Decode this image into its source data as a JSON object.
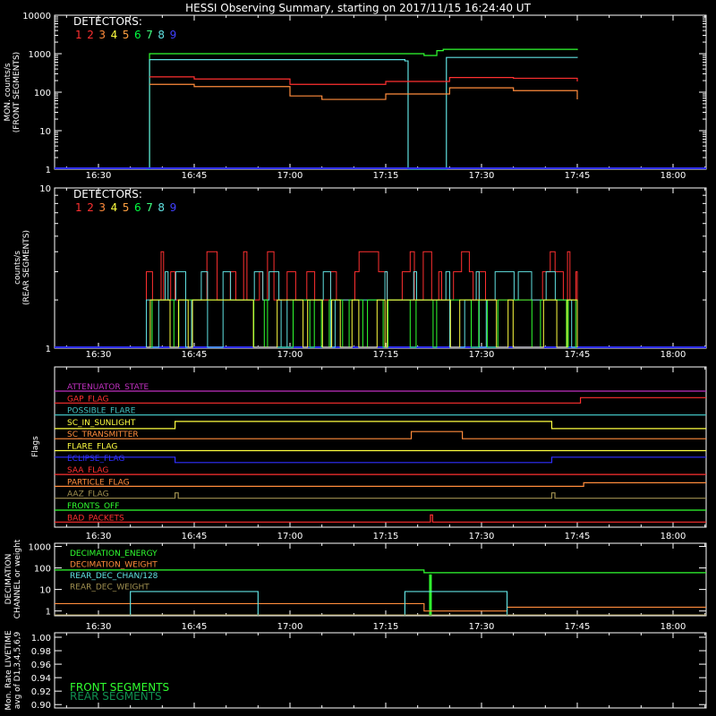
{
  "title": "HESSI Observing Summary, starting on 2017/11/15 16:24:40 UT",
  "x_tick_labels": [
    "16:30",
    "16:45",
    "17:00",
    "17:15",
    "17:30",
    "17:45",
    "18:00"
  ],
  "colors": {
    "axes": "#ffffff",
    "det": [
      "#ff3030",
      "#ff3030",
      "#ff8c3c",
      "#ffff40",
      "#ffa040",
      "#00ff40",
      "#40ff80",
      "#60e0e0",
      "#4040ff"
    ],
    "front_green": "#30ff30",
    "front_red": "#ff3030",
    "front_orange": "#ff8c3c",
    "front_cyan": "#60e0e0",
    "blue": "#3030ff"
  },
  "detectors": {
    "label": "DETECTORS:",
    "numbers": [
      "1",
      "2",
      "3",
      "4",
      "5",
      "6",
      "7",
      "8",
      "9"
    ]
  },
  "panels": {
    "front": {
      "ylabel_1": "MON. counts/s",
      "ylabel_2": "(FRONT SEGMENTS)",
      "yticks": [
        "10000",
        "1000",
        "100",
        "10",
        "1"
      ]
    },
    "rear": {
      "ylabel_1": "counts/s",
      "ylabel_2": "(REAR SEGMENTS)",
      "yticks": [
        "10",
        "1"
      ]
    },
    "flags": {
      "ylabel": "Flags",
      "items": [
        {
          "label": "ATTENUATOR_STATE",
          "color": "#c030c0"
        },
        {
          "label": "GAP_FLAG",
          "color": "#ff3030"
        },
        {
          "label": "POSSIBLE_FLARE",
          "color": "#40c0c0"
        },
        {
          "label": "SC_IN_SUNLIGHT",
          "color": "#ffff40"
        },
        {
          "label": "SC_TRANSMITTER",
          "color": "#ff8c3c"
        },
        {
          "label": "FLARE_FLAG",
          "color": "#ffff40"
        },
        {
          "label": "ECLIPSE_FLAG",
          "color": "#3030ff"
        },
        {
          "label": "SAA_FLAG",
          "color": "#ff3030"
        },
        {
          "label": "PARTICLE_FLAG",
          "color": "#ff8c3c"
        },
        {
          "label": "AAZ_FLAG",
          "color": "#a09050"
        },
        {
          "label": "FRONTS_OFF",
          "color": "#30ff30"
        },
        {
          "label": "BAD_PACKETS",
          "color": "#ff3030"
        }
      ]
    },
    "decimation": {
      "ylabel_1": "DECIMATION",
      "ylabel_2": "CHANNEL or weight",
      "yticks": [
        "1000",
        "100",
        "10",
        "1"
      ],
      "legend": [
        {
          "label": "DECIMATION_ENERGY",
          "color": "#30ff30"
        },
        {
          "label": "DECIMATION_WEIGHT",
          "color": "#ff8c3c"
        },
        {
          "label": "REAR_DEC_CHAN/128",
          "color": "#60e0e0"
        },
        {
          "label": "REAR_DEC_WEIGHT",
          "color": "#a09050"
        }
      ]
    },
    "livetime": {
      "ylabel_1": "Mon. Rate LIVETIME",
      "ylabel_2": "avg of D1,3,4,5,6,9",
      "yticks": [
        "1.00",
        "0.98",
        "0.96",
        "0.94",
        "0.92",
        "0.90"
      ],
      "legend": [
        {
          "label": "FRONT SEGMENTS",
          "color": "#30ff30"
        },
        {
          "label": "REAR SEGMENTS",
          "color": "#109050"
        }
      ]
    }
  },
  "chart_data": [
    {
      "type": "line",
      "title": "HESSI Observing Summary, starting on 2017/11/15 16:24:40 UT",
      "ylabel": "MON. counts/s (FRONT SEGMENTS)",
      "yscale": "log",
      "ylim": [
        1,
        10000
      ],
      "x_unit": "UT",
      "series": [
        {
          "name": "Detector 6",
          "color": "#30ff30",
          "x": [
            "16:37:30",
            "16:38",
            "17:20",
            "17:21",
            "17:23",
            "17:24",
            "17:45"
          ],
          "values": [
            1,
            1000,
            1000,
            900,
            1200,
            1300,
            1250
          ]
        },
        {
          "name": "Detector 8",
          "color": "#60e0e0",
          "x": [
            "16:37:30",
            "16:38",
            "17:18",
            "17:18:30",
            "17:24",
            "17:24:30",
            "17:45"
          ],
          "values": [
            1,
            700,
            650,
            1,
            1,
            800,
            780
          ]
        },
        {
          "name": "Detector 1",
          "color": "#ff3030",
          "x": [
            "16:38",
            "16:45",
            "17:00",
            "17:15",
            "17:25",
            "17:35",
            "17:45"
          ],
          "values": [
            250,
            220,
            160,
            190,
            240,
            230,
            190
          ]
        },
        {
          "name": "Detector 3",
          "color": "#ff8c3c",
          "x": [
            "16:38",
            "16:45",
            "17:00",
            "17:05",
            "17:15",
            "17:25",
            "17:35",
            "17:45"
          ],
          "values": [
            160,
            140,
            80,
            65,
            90,
            130,
            110,
            65
          ]
        }
      ]
    },
    {
      "type": "line",
      "ylabel": "counts/s (REAR SEGMENTS)",
      "yscale": "log",
      "ylim": [
        1,
        10
      ],
      "note_levels": [
        2,
        3,
        4
      ],
      "active_interval": [
        "16:37:30",
        "17:45"
      ]
    }
  ]
}
